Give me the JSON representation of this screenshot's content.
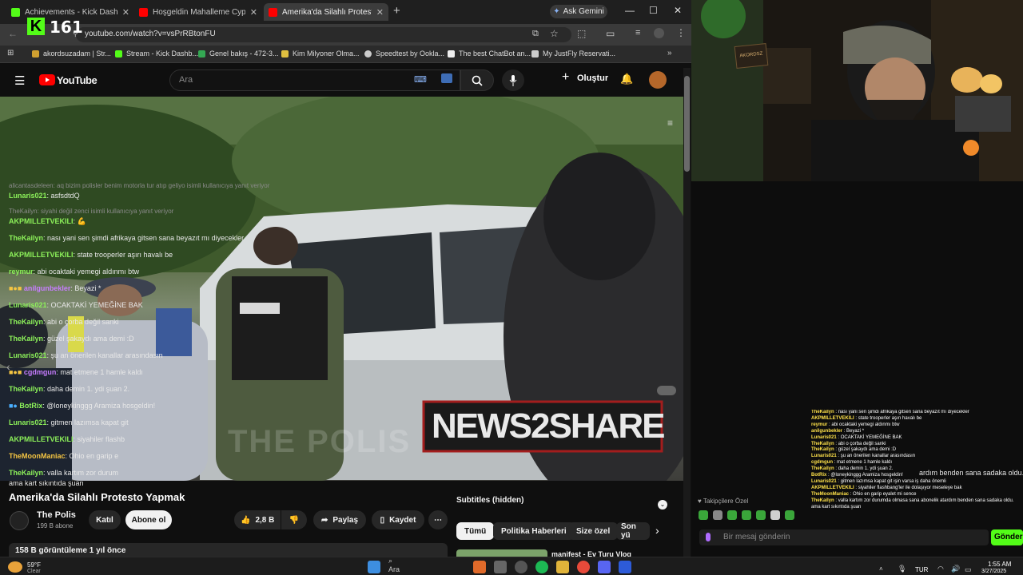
{
  "browser": {
    "tabs": [
      {
        "title": "Achievements - Kick Dashboard",
        "color": "#53fc18"
      },
      {
        "title": "Hoşgeldin Mahalleme Cypher",
        "color": "#ff0000"
      },
      {
        "title": "Amerika'da Silahlı Protesto Yap",
        "color": "#ff0000",
        "active": true
      }
    ],
    "new_tab": "+",
    "gemini_label": "Ask Gemini",
    "url": "youtube.com/watch?v=vsPrRBtonFU",
    "bookmarks": [
      {
        "label": "akordsuzadam | Str...",
        "color": "#d0a030"
      },
      {
        "label": "Stream - Kick Dashb...",
        "color": "#53fc18"
      },
      {
        "label": "Genel bakış - 472-3...",
        "color": "#34a853"
      },
      {
        "label": "Kim Milyoner Olma...",
        "color": "#e0c040"
      },
      {
        "label": "Speedtest by Ookla...",
        "color": "#cccccc"
      },
      {
        "label": "The best ChatBot an...",
        "color": "#eeeeee"
      },
      {
        "label": "My JustFly Reservati...",
        "color": "#cccccc"
      }
    ]
  },
  "kick": {
    "viewer_count": "161",
    "logo": "K"
  },
  "youtube": {
    "logo_text": "YouTube",
    "search_placeholder": "Ara",
    "create_label": "Oluştur",
    "video_title": "Amerika'da Silahlı Protesto Yapmak",
    "channel_name": "The Polis",
    "subscribers": "199 B abone",
    "join_label": "Katıl",
    "subscribe_label": "Abone ol",
    "likes": "2,8 B",
    "share_label": "Paylaş",
    "save_label": "Kaydet",
    "views_line": "158 B görüntüleme  1 yıl önce",
    "subtitles_label": "Subtitles (hidden)",
    "chips": [
      "Tümü",
      "Politika Haberleri",
      "Size özel",
      "Son yü"
    ],
    "next_video": "manifest - Ev Turu Vlog",
    "watermark": "NEWS2SHARE",
    "ghost_text": "THE POLIS"
  },
  "chat": {
    "messages": [
      {
        "type": "reply",
        "text": "alicantasdeleen: aq bizim polisler benim motorla tur atıp geliyo isimli kullanıcıya yanıt veriyor"
      },
      {
        "user": "Lunaris021",
        "color": "#8df25a",
        "text": "asfsdtdQ"
      },
      {
        "type": "reply",
        "text": "TheKailyn: siyahi değil zenci isimli kullanıcıya yanıt veriyor"
      },
      {
        "user": "AKPMILLETVEKILI",
        "color": "#8df25a",
        "text": "💪"
      },
      {
        "user": "TheKailyn",
        "color": "#8df25a",
        "text": "nası yani sen şimdi afrikaya gitsen sana beyazıt mı diyecekler"
      },
      {
        "user": "AKPMILLETVEKILI",
        "color": "#8df25a",
        "text": "state trooperler aşırı havalı be"
      },
      {
        "user": "reymur",
        "color": "#8df25a",
        "text": "abi ocaktaki yemegi aldınmı btw"
      },
      {
        "user": "anilgunbekler",
        "color": "#c77dff",
        "text": "Beyazi *",
        "badges": true
      },
      {
        "user": "Lunaris021",
        "color": "#8df25a",
        "text": "OCAKTAKİ YEMEĞİNE BAK"
      },
      {
        "user": "TheKailyn",
        "color": "#8df25a",
        "text": "abi o çorba değil sanki"
      },
      {
        "user": "TheKailyn",
        "color": "#8df25a",
        "text": "güzel şakaydı ama demi :D"
      },
      {
        "user": "Lunaris021",
        "color": "#8df25a",
        "text": "şu an önerilen kanallar arasındasın"
      },
      {
        "user": "cgdmgun",
        "color": "#c77dff",
        "text": "mat etmene 1 hamle kaldı",
        "badges": true
      },
      {
        "user": "TheKailyn",
        "color": "#8df25a",
        "text": "daha demin 1. ydi şuan 2."
      },
      {
        "user": "BotRix",
        "color": "#8df25a",
        "text": "@loneykinggg Aramiza hosgeldin!",
        "bot": true
      },
      {
        "user": "Lunaris021",
        "color": "#8df25a",
        "text": "gitmen lazımsa kapat git"
      },
      {
        "user": "AKPMILLETVEKILI",
        "color": "#8df25a",
        "text": "siyahiler flashb"
      },
      {
        "user": "TheMoonManiac",
        "color": "#f5c542",
        "text": "Ohio en garip e"
      },
      {
        "user": "TheKailyn",
        "color": "#8df25a",
        "text": "valla kartım zor durum"
      }
    ],
    "wrap_tail_right": "ardım benden sana sadaka oldu.",
    "wrap_line": "ama kart sıkıntıda şuan",
    "takipciler_label": "Takipçilere Özel",
    "input_placeholder": "Bir mesaj gönderin",
    "send_label": "Gönder"
  },
  "overlay_lines": [
    {
      "user": "TheKailyn",
      "text": "nası yani sen şimdi afrikaya gitsen sana beyazıt mı diyecekler"
    },
    {
      "user": "AKPMILLETVEKILI",
      "text": "state trooperler aşırı havalı be"
    },
    {
      "user": "reymur",
      "text": "abi ocaktaki yemegi aldınmı btw"
    },
    {
      "user": "anilgunbekler",
      "text": "Beyazi *"
    },
    {
      "user": "Lunaris021",
      "text": "OCAKTAKİ YEMEĞİNE BAK"
    },
    {
      "user": "TheKailyn",
      "text": "abi o çorba değil sanki"
    },
    {
      "user": "TheKailyn",
      "text": "güzel şakaydı ama demi :D"
    },
    {
      "user": "Lunaris021",
      "text": "şu an önerilen kanallar arasındasın"
    },
    {
      "user": "cgdmgun",
      "text": "mat etmene 1 hamle kaldı"
    },
    {
      "user": "TheKailyn",
      "text": "daha demin 1. ydi şuan 2."
    },
    {
      "user": "BotRix",
      "text": "@loneykinggg Aramiza hosgeldin!"
    },
    {
      "user": "Lunaris021",
      "text": "gitmen lazımsa kapat git işin varsa iş daha önemli"
    },
    {
      "user": "AKPMILLETVEKILI",
      "text": "siyahiler flashbang'ler ile dolaşıyor meseleye bak"
    },
    {
      "user": "TheMoonManiac",
      "text": "Ohio en garip eyalet mi sence"
    },
    {
      "user": "TheKailyn",
      "text": "valla kartım zor durumda olmasa sana abonelik atardım benden sana sadaka oldu. ama kart sıkıntıda şuan"
    }
  ],
  "taskbar": {
    "temperature": "59°F",
    "weather": "Clear",
    "search_label": "Ara",
    "language": "TUR",
    "time": "1:55 AM",
    "date": "3/27/2025"
  }
}
